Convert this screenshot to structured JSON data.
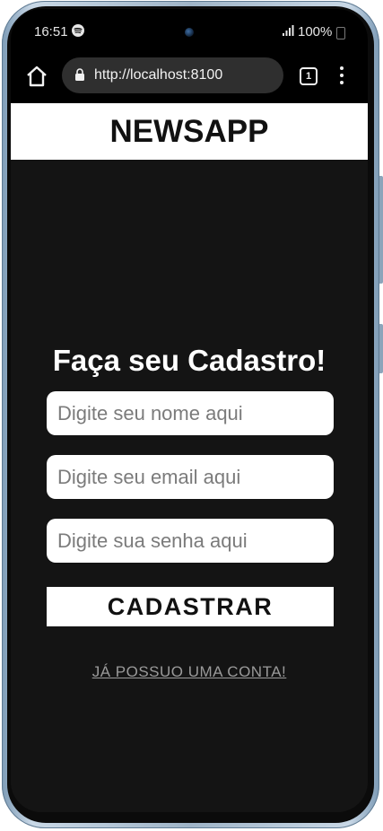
{
  "status_bar": {
    "time": "16:51",
    "battery": "100%"
  },
  "browser": {
    "url": "http://localhost:8100",
    "tab_count": "1"
  },
  "app": {
    "title": "NEWSAPP"
  },
  "form": {
    "heading": "Faça seu Cadastro!",
    "name_placeholder": "Digite seu nome aqui",
    "email_placeholder": "Digite seu email aqui",
    "password_placeholder": "Digite sua senha aqui",
    "submit_label": "CADASTRAR",
    "login_link": "JÁ POSSUO UMA CONTA!"
  },
  "colors": {
    "background": "#141414",
    "header_background": "#ffffff",
    "link": "#9a9a9a"
  }
}
